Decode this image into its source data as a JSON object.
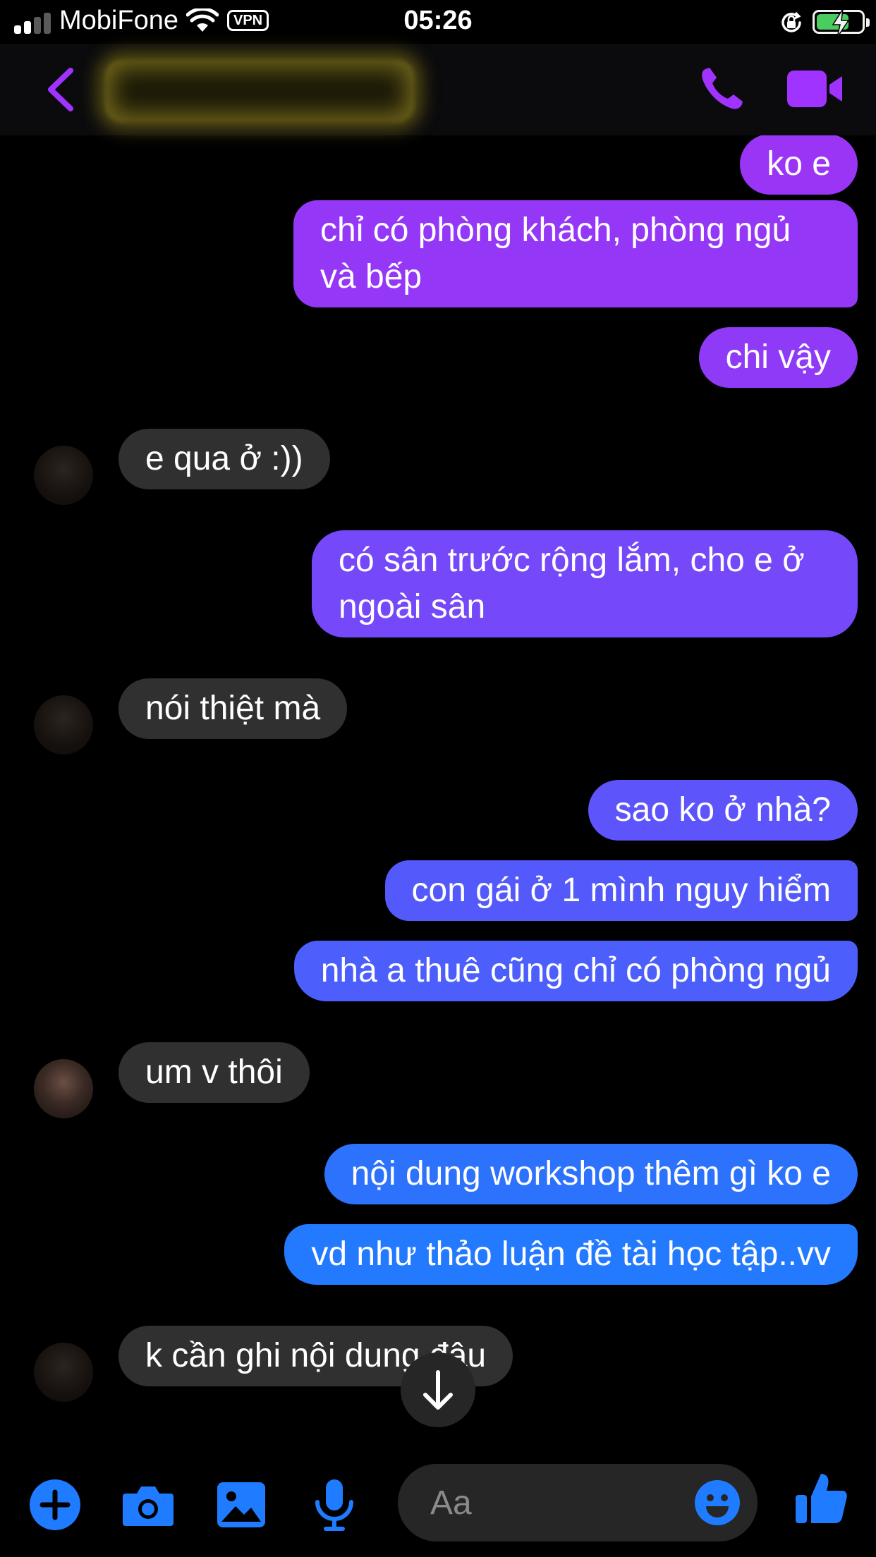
{
  "status_bar": {
    "carrier": "MobiFone",
    "vpn": "VPN",
    "time": "05:26",
    "signal_bars_active": 2,
    "signal_bars_total": 4,
    "battery_level": 0.75,
    "icons": [
      "signal-icon",
      "wifi-icon",
      "vpn-badge",
      "rotation-lock-icon",
      "battery-charging-icon"
    ]
  },
  "header": {
    "contact_name": "",
    "contact_name_redacted": true,
    "icons": [
      "back-chevron-icon",
      "phone-icon",
      "video-camera-icon"
    ]
  },
  "colors": {
    "accent": "#a033ff",
    "outgoing_gradient_top": "#9d36f5",
    "outgoing_gradient_bottom": "#1f7bff",
    "incoming_bubble": "#303030",
    "composer_icon": "#1f7bff"
  },
  "messages": [
    {
      "direction": "out",
      "text": "ko e"
    },
    {
      "direction": "out",
      "text": "chỉ có phòng khách, phòng ngủ và bếp"
    },
    {
      "direction": "out",
      "text": "chi vậy"
    },
    {
      "direction": "in",
      "text": "e qua ở :))"
    },
    {
      "direction": "out",
      "text": "có sân trước rộng lắm, cho e ở ngoài sân"
    },
    {
      "direction": "in",
      "text": "nói thiệt mà"
    },
    {
      "direction": "out",
      "text": "sao ko ở nhà?"
    },
    {
      "direction": "out",
      "text": "con gái ở 1 mình nguy hiểm"
    },
    {
      "direction": "out",
      "text": "nhà a thuê cũng chỉ có phòng ngủ"
    },
    {
      "direction": "in",
      "text": "um v thôi"
    },
    {
      "direction": "out",
      "text": "nội dung workshop thêm gì ko e"
    },
    {
      "direction": "out",
      "text": "vd như thảo luận đề tài học tập..vv"
    },
    {
      "direction": "in",
      "text": "k cần ghi nội dung đâu"
    }
  ],
  "composer": {
    "placeholder": "Aa",
    "icons": [
      "add-icon",
      "camera-icon",
      "gallery-icon",
      "microphone-icon",
      "emoji-icon",
      "thumbs-up-icon"
    ]
  },
  "scroll_down_icon": "arrow-down-icon"
}
